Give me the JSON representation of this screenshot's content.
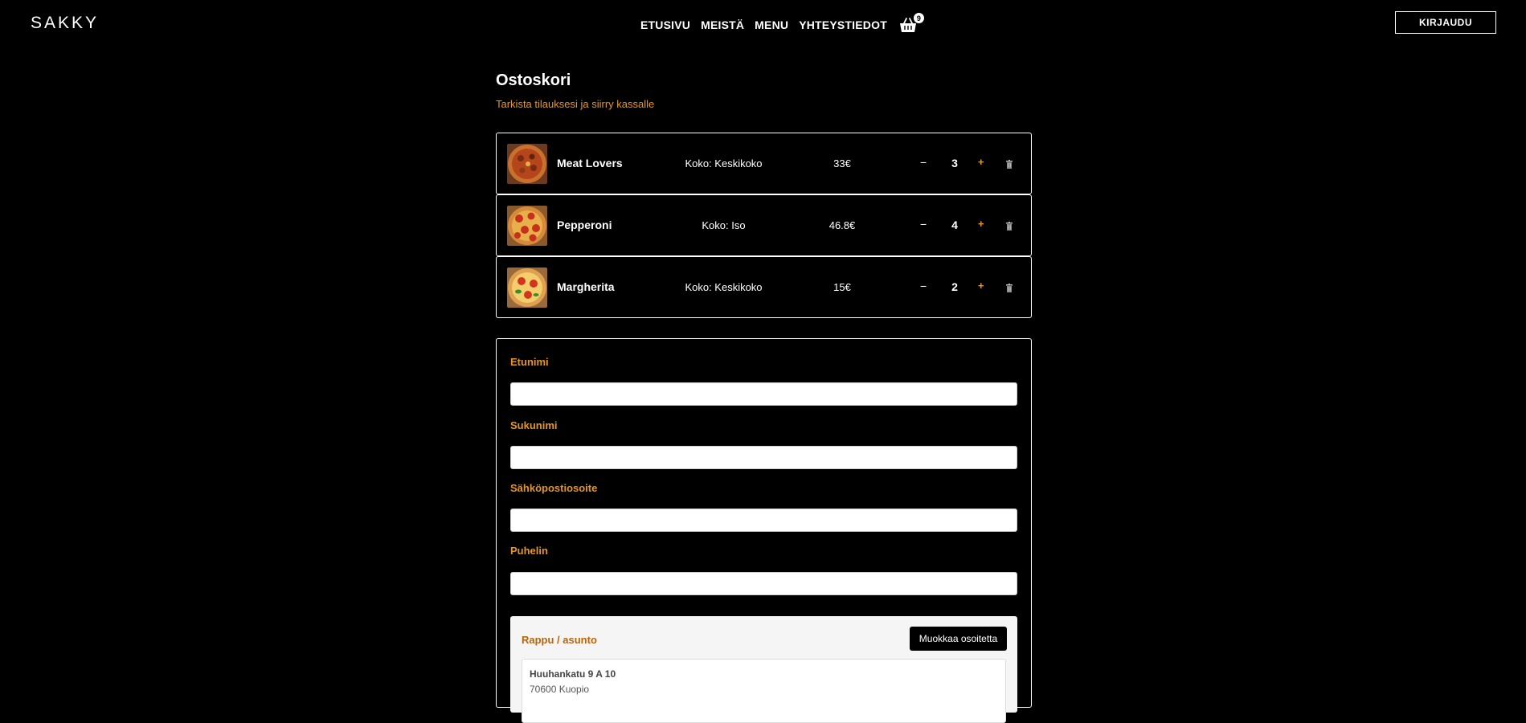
{
  "header": {
    "logo": "SAKKY",
    "nav": [
      "ETUSIVU",
      "MEISTÄ",
      "MENU",
      "YHTEYSTIEDOT"
    ],
    "cart_count": "9",
    "login_label": "KIRJAUDU"
  },
  "page": {
    "title": "Ostoskori",
    "subtitle": "Tarkista tilauksesi ja siirry kassalle"
  },
  "cart": {
    "items": [
      {
        "name": "Meat Lovers",
        "size": "Koko: Keskikoko",
        "price": "33€",
        "qty": "3",
        "minus": "−",
        "plus": "+"
      },
      {
        "name": "Pepperoni",
        "size": "Koko: Iso",
        "price": "46.8€",
        "qty": "4",
        "minus": "−",
        "plus": "+"
      },
      {
        "name": "Margherita",
        "size": "Koko: Keskikoko",
        "price": "15€",
        "qty": "2",
        "minus": "−",
        "plus": "+"
      }
    ]
  },
  "form": {
    "first_name_label": "Etunimi",
    "last_name_label": "Sukunimi",
    "email_label": "Sähköpostiosoite",
    "phone_label": "Puhelin",
    "address": {
      "label": "Rappu / asunto",
      "edit_label": "Muokkaa osoitetta",
      "street": "Huuhankatu 9 A 10",
      "city": "70600 Kuopio"
    }
  },
  "colors": {
    "accent": "#e8971e",
    "background": "#000000",
    "text": "#ffffff"
  },
  "icons": [
    "shopping-basket-icon",
    "trash-icon",
    "pizza-image"
  ]
}
